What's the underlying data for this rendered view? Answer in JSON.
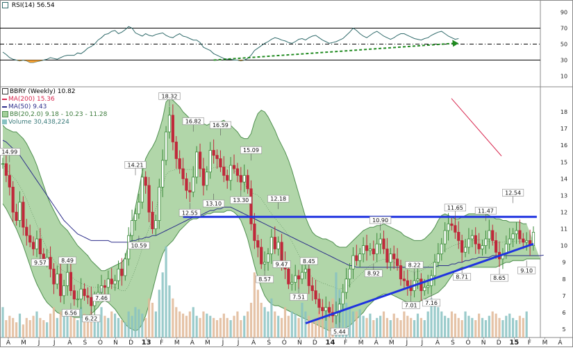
{
  "chart_data": {
    "type": "line",
    "title": "BBRY (Weekly) 10.82",
    "colors": {
      "price_up": "#3a8a3a",
      "price_down": "#c0283a",
      "bb_fill": "#a3cf9a",
      "bb_line": "#4f8f4f",
      "ma200": "#d8274f",
      "ma50": "#2b2d8a",
      "trendline": "#1f33e0",
      "rsi_line": "#2f6a6a",
      "rsi_arrow": "#1f8a1f",
      "rsi_oversold_fill": "#f5a033",
      "volume_up": "#88c2c2",
      "volume_down": "#e0b898"
    },
    "rsi": {
      "label": "RSI(14)",
      "value": "56.54",
      "ylim": [
        0,
        100
      ],
      "ticks": [
        "90",
        "70",
        "50",
        "30",
        "10"
      ],
      "levels": [
        70,
        50,
        30
      ],
      "series": [
        40,
        37,
        33,
        31,
        30,
        29,
        30,
        29,
        27,
        27,
        28,
        29,
        30,
        31,
        33,
        32,
        31,
        33,
        35,
        36,
        36,
        36,
        39,
        38,
        41,
        45,
        47,
        50,
        55,
        58,
        62,
        63,
        66,
        67,
        63,
        65,
        68,
        72,
        70,
        64,
        62,
        60,
        63,
        61,
        60,
        62,
        63,
        64,
        61,
        59,
        58,
        61,
        63,
        60,
        59,
        57,
        55,
        55,
        52,
        46,
        44,
        42,
        38,
        36,
        34,
        32,
        31,
        31,
        30,
        30,
        29,
        30,
        32,
        36,
        42,
        45,
        48,
        51,
        53,
        56,
        58,
        57,
        55,
        54,
        52,
        51,
        53,
        56,
        57,
        55,
        58,
        60,
        61,
        58,
        55,
        53,
        51,
        52,
        53,
        55,
        57,
        61,
        65,
        70,
        67,
        63,
        60,
        58,
        61,
        64,
        66,
        63,
        60,
        58,
        56,
        58,
        61,
        63,
        63,
        61,
        59,
        57,
        56,
        55,
        57,
        58,
        61,
        63,
        65,
        66,
        63,
        60,
        58,
        56,
        57
      ],
      "arrow": {
        "from": [
          62,
          30
        ],
        "to": [
          134,
          51
        ]
      }
    },
    "price": {
      "ylim": [
        4.5,
        19.5
      ],
      "ticks": [
        "18",
        "17",
        "16",
        "15",
        "14",
        "13",
        "12",
        "11",
        "10",
        "9",
        "8",
        "7",
        "6",
        "5"
      ],
      "legend": [
        {
          "text": "BBRY (Weekly) 10.82",
          "color": "#000000",
          "swatch": "candle"
        },
        {
          "text": "MA(200) 15.36",
          "color": "#d8274f",
          "swatch": "line"
        },
        {
          "text": "MA(50) 9.43",
          "color": "#2b2d8a",
          "swatch": "line"
        },
        {
          "text": "BB(20,2.0) 9.18 - 10.23 - 11.28",
          "color": "#3a7a3a",
          "swatch": "band"
        },
        {
          "text": "Volume 30,438,224",
          "color": "#3a7a7a",
          "swatch": "bars"
        }
      ],
      "close": [
        14.9,
        14.2,
        13.5,
        12.0,
        11.5,
        12.6,
        11.1,
        10.6,
        10.2,
        9.8,
        10.4,
        9.5,
        9.1,
        9.3,
        8.6,
        7.7,
        8.3,
        7.0,
        7.6,
        8.4,
        7.3,
        6.8,
        6.8,
        7.4,
        7.0,
        6.9,
        6.4,
        6.9,
        7.2,
        7.6,
        7.5,
        8.0,
        7.7,
        7.9,
        8.6,
        8.2,
        9.2,
        10.6,
        11.5,
        11.9,
        12.6,
        14.1,
        13.6,
        12.0,
        11.0,
        11.5,
        13.5,
        15.1,
        16.8,
        17.8,
        16.2,
        15.2,
        14.6,
        14.0,
        13.3,
        13.2,
        14.1,
        15.6,
        14.6,
        13.6,
        14.4,
        15.7,
        15.4,
        15.2,
        14.7,
        14.2,
        13.9,
        14.8,
        14.6,
        14.2,
        13.8,
        14.2,
        13.4,
        11.3,
        10.3,
        9.9,
        8.9,
        9.0,
        9.5,
        10.5,
        9.8,
        10.2,
        9.0,
        8.6,
        7.7,
        7.8,
        8.2,
        8.0,
        8.4,
        8.6,
        7.6,
        7.3,
        6.8,
        6.3,
        6.1,
        6.3,
        6.0,
        5.8,
        6.0,
        6.5,
        7.2,
        8.0,
        8.6,
        9.4,
        9.1,
        9.5,
        10.0,
        9.7,
        9.8,
        9.5,
        10.1,
        10.4,
        9.8,
        9.0,
        9.5,
        9.2,
        8.8,
        8.0,
        7.9,
        7.6,
        7.3,
        7.9,
        8.0,
        7.3,
        7.5,
        7.6,
        8.2,
        9.0,
        9.5,
        10.1,
        10.9,
        11.3,
        11.2,
        10.8,
        10.3,
        9.6,
        9.9,
        10.4,
        10.6,
        10.1,
        9.8,
        10.0,
        10.4,
        10.9,
        10.3,
        9.6,
        9.2,
        9.5,
        10.1,
        10.4,
        10.7,
        10.9,
        10.4,
        10.2,
        10.3,
        10.0,
        10.8
      ],
      "bb_upper": [
        17.2,
        17.0,
        16.9,
        16.8,
        16.8,
        16.6,
        16.4,
        16.1,
        15.7,
        15.3,
        14.8,
        14.2,
        13.6,
        13.0,
        12.5,
        12.1,
        11.7,
        11.3,
        11.1,
        10.9,
        10.6,
        10.3,
        10.0,
        9.8,
        9.6,
        9.4,
        9.1,
        8.9,
        8.7,
        8.5,
        8.5,
        8.6,
        8.7,
        8.8,
        8.9,
        9.0,
        9.3,
        10.1,
        11.2,
        12.3,
        13.3,
        14.4,
        15.2,
        15.6,
        15.9,
        16.3,
        16.9,
        17.6,
        18.6,
        18.8,
        18.7,
        18.5,
        18.3,
        18.0,
        17.8,
        17.6,
        17.5,
        17.6,
        17.5,
        17.3,
        17.2,
        17.3,
        17.3,
        17.4,
        17.4,
        17.5,
        17.3,
        17.2,
        17.0,
        16.8,
        16.5,
        16.4,
        16.4,
        16.7,
        17.4,
        17.9,
        18.1,
        18.0,
        17.7,
        17.3,
        16.9,
        16.4,
        16.0,
        15.6,
        15.1,
        14.5,
        13.8,
        13.1,
        12.4,
        11.7,
        11.2,
        10.8,
        10.6,
        10.5,
        10.4,
        10.4,
        10.3,
        10.2,
        10.0,
        9.9,
        9.9,
        9.9,
        10.1,
        10.3,
        10.5,
        10.7,
        10.9,
        11.0,
        11.1,
        11.1,
        11.2,
        11.2,
        11.3,
        11.2,
        11.1,
        11.0,
        10.9,
        10.8,
        10.6,
        10.5,
        10.4,
        10.3,
        10.3,
        10.3,
        10.4,
        10.6,
        10.8,
        11.1,
        11.5,
        11.8,
        11.9,
        11.8,
        11.7,
        11.6,
        11.6,
        11.7,
        11.8,
        11.9,
        11.9,
        11.9,
        12.0,
        12.0,
        11.9,
        11.8,
        11.7,
        11.6,
        11.6,
        11.5,
        11.5,
        11.4,
        11.4,
        11.4,
        11.4,
        11.3,
        11.3
      ],
      "bb_lower": [
        12.5,
        12.2,
        11.8,
        11.4,
        11.0,
        10.5,
        10.0,
        9.4,
        8.8,
        8.2,
        7.7,
        7.3,
        6.9,
        6.6,
        6.4,
        6.2,
        6.0,
        5.9,
        5.8,
        5.8,
        5.8,
        5.7,
        5.7,
        5.7,
        5.7,
        5.8,
        5.9,
        6.1,
        6.3,
        6.6,
        6.7,
        6.6,
        6.4,
        6.2,
        5.9,
        5.6,
        5.3,
        5.1,
        5.0,
        4.9,
        5.0,
        5.3,
        5.8,
        6.5,
        7.3,
        8.1,
        8.9,
        9.5,
        9.9,
        10.1,
        10.3,
        10.6,
        10.9,
        11.1,
        11.3,
        11.5,
        11.6,
        11.6,
        11.7,
        11.8,
        11.9,
        11.9,
        12.0,
        12.0,
        12.0,
        12.0,
        12.1,
        12.1,
        12.0,
        11.8,
        11.5,
        11.0,
        10.4,
        9.6,
        8.8,
        8.1,
        7.5,
        7.0,
        6.7,
        6.5,
        6.4,
        6.4,
        6.3,
        6.2,
        6.1,
        6.0,
        5.9,
        5.8,
        5.7,
        5.6,
        5.5,
        5.4,
        5.3,
        5.2,
        5.1,
        5.0,
        4.9,
        4.9,
        4.9,
        4.9,
        5.0,
        5.1,
        5.2,
        5.4,
        5.6,
        5.8,
        6.0,
        6.3,
        6.5,
        6.7,
        6.9,
        7.0,
        7.1,
        7.1,
        7.1,
        7.0,
        6.9,
        6.8,
        6.7,
        6.6,
        6.5,
        6.5,
        6.6,
        6.7,
        6.8,
        6.9,
        7.0,
        7.1,
        7.2,
        7.4,
        7.6,
        7.9,
        8.2,
        8.5,
        8.6,
        8.7,
        8.7,
        8.7,
        8.7,
        8.7,
        8.7,
        8.7,
        8.7,
        8.7,
        8.7,
        8.7,
        8.8,
        8.9,
        9.0,
        9.0,
        9.1,
        9.1,
        9.1,
        9.1,
        9.2,
        9.2,
        9.2,
        9.2,
        9.2
      ],
      "ma50": [
        16.3,
        16.2,
        16.0,
        15.8,
        15.6,
        15.4,
        15.1,
        14.8,
        14.5,
        14.2,
        13.9,
        13.6,
        13.3,
        13.0,
        12.7,
        12.4,
        12.1,
        11.8,
        11.5,
        11.3,
        11.1,
        10.9,
        10.7,
        10.6,
        10.5,
        10.4,
        10.3,
        10.3,
        10.3,
        10.3,
        10.3,
        10.3,
        10.2,
        10.2,
        10.2,
        10.2,
        10.2,
        10.2,
        10.3,
        10.3,
        10.4,
        10.4,
        10.5,
        10.5,
        10.6,
        10.6,
        10.7,
        10.8,
        10.9,
        11.0,
        11.1,
        11.2,
        11.3,
        11.4,
        11.5,
        11.6,
        11.7,
        11.7,
        11.8,
        11.9,
        12.0,
        12.1,
        12.1,
        12.2,
        12.2,
        12.3,
        12.3,
        12.3,
        12.2,
        12.1,
        12.0,
        11.9,
        11.8,
        11.7,
        11.6,
        11.5,
        11.4,
        11.3,
        11.2,
        11.1,
        11.0,
        10.9,
        10.8,
        10.7,
        10.6,
        10.5,
        10.4,
        10.3,
        10.2,
        10.1,
        10.0,
        9.9,
        9.8,
        9.7,
        9.6,
        9.5,
        9.4,
        9.3,
        9.2,
        9.1,
        9.0,
        8.9,
        8.8,
        8.8,
        8.7,
        8.7,
        8.7,
        8.7,
        8.7,
        8.7,
        8.7,
        8.7,
        8.7,
        8.7,
        8.7,
        8.7,
        8.7,
        8.7,
        8.7,
        8.7,
        8.7,
        8.7,
        8.7,
        8.7,
        8.7,
        8.7,
        8.7,
        8.7,
        8.8,
        8.8,
        8.8,
        8.8,
        8.9,
        8.9,
        9.0,
        9.0,
        9.1,
        9.1,
        9.2,
        9.2,
        9.3,
        9.3,
        9.3,
        9.3,
        9.4,
        9.4,
        9.4,
        9.4,
        9.4,
        9.4,
        9.4,
        9.4,
        9.4,
        9.4,
        9.4,
        9.4,
        9.4,
        9.4,
        9.4,
        9.43
      ],
      "ma200_segment": {
        "from": [
          650,
          15.0
        ],
        "to": [
          722,
          15.36
        ]
      },
      "resistance": {
        "from_idx": 53,
        "to_idx": 157,
        "value": 11.72
      },
      "support": {
        "from": [
          440,
          5.35
        ],
        "to": [
          768,
          10.1
        ]
      },
      "annotations": [
        {
          "label": "14.99",
          "idx": 2,
          "value": 14.99,
          "pos": "above"
        },
        {
          "label": "9.57",
          "idx": 11,
          "value": 9.57,
          "pos": "below"
        },
        {
          "label": "8.49",
          "idx": 19,
          "value": 8.49,
          "pos": "above"
        },
        {
          "label": "6.56",
          "idx": 20,
          "value": 6.56,
          "pos": "below"
        },
        {
          "label": "7.46",
          "idx": 29,
          "value": 7.46,
          "pos": "below"
        },
        {
          "label": "6.22",
          "idx": 26,
          "value": 6.22,
          "pos": "below"
        },
        {
          "label": "14.21",
          "idx": 39,
          "value": 14.21,
          "pos": "above"
        },
        {
          "label": "10.59",
          "idx": 40,
          "value": 10.59,
          "pos": "below"
        },
        {
          "label": "18.32",
          "idx": 49,
          "value": 18.32,
          "pos": "above"
        },
        {
          "label": "16.82",
          "idx": 56,
          "value": 16.82,
          "pos": "above"
        },
        {
          "label": "12.55",
          "idx": 55,
          "value": 12.55,
          "pos": "below"
        },
        {
          "label": "16.59",
          "idx": 64,
          "value": 16.59,
          "pos": "above"
        },
        {
          "label": "13.10",
          "idx": 62,
          "value": 13.1,
          "pos": "below"
        },
        {
          "label": "15.09",
          "idx": 73,
          "value": 15.09,
          "pos": "above"
        },
        {
          "label": "13.30",
          "idx": 70,
          "value": 13.3,
          "pos": "below"
        },
        {
          "label": "12.18",
          "idx": 81,
          "value": 12.18,
          "pos": "above"
        },
        {
          "label": "9.47",
          "idx": 82,
          "value": 9.47,
          "pos": "below"
        },
        {
          "label": "8.57",
          "idx": 77,
          "value": 8.57,
          "pos": "below"
        },
        {
          "label": "8.45",
          "idx": 90,
          "value": 8.45,
          "pos": "above"
        },
        {
          "label": "7.51",
          "idx": 87,
          "value": 7.51,
          "pos": "below"
        },
        {
          "label": "5.44",
          "idx": 99,
          "value": 5.44,
          "pos": "below"
        },
        {
          "label": "10.90",
          "idx": 111,
          "value": 10.9,
          "pos": "above"
        },
        {
          "label": "8.92",
          "idx": 109,
          "value": 8.92,
          "pos": "below"
        },
        {
          "label": "8.22",
          "idx": 121,
          "value": 8.22,
          "pos": "above"
        },
        {
          "label": "7.01",
          "idx": 120,
          "value": 7.01,
          "pos": "below"
        },
        {
          "label": "7.16",
          "idx": 126,
          "value": 7.16,
          "pos": "below"
        },
        {
          "label": "11.65",
          "idx": 133,
          "value": 11.65,
          "pos": "above"
        },
        {
          "label": "8.71",
          "idx": 135,
          "value": 8.71,
          "pos": "below"
        },
        {
          "label": "11.47",
          "idx": 142,
          "value": 11.47,
          "pos": "above"
        },
        {
          "label": "8.65",
          "idx": 146,
          "value": 8.65,
          "pos": "below"
        },
        {
          "label": "12.54",
          "idx": 150,
          "value": 12.54,
          "pos": "above"
        },
        {
          "label": "9.10",
          "idx": 154,
          "value": 9.1,
          "pos": "below"
        }
      ]
    },
    "volume": {
      "values": [
        14,
        8,
        10,
        9,
        7,
        11,
        6,
        9,
        8,
        10,
        12,
        9,
        8,
        7,
        11,
        14,
        9,
        12,
        13,
        10,
        11,
        9,
        8,
        14,
        11,
        9,
        12,
        10,
        8,
        14,
        10,
        9,
        12,
        11,
        9,
        8,
        7,
        12,
        10,
        14,
        13,
        11,
        9,
        18,
        16,
        12,
        22,
        30,
        42,
        24,
        18,
        14,
        12,
        11,
        10,
        12,
        14,
        10,
        9,
        12,
        11,
        10,
        9,
        8,
        9,
        11,
        9,
        8,
        10,
        12,
        8,
        10,
        12,
        16,
        30,
        22,
        16,
        14,
        12,
        18,
        12,
        10,
        9,
        14,
        10,
        12,
        11,
        9,
        16,
        12,
        10,
        8,
        9,
        12,
        16,
        14,
        12,
        18,
        30,
        22,
        20,
        16,
        14,
        12,
        12,
        13,
        10,
        9,
        11,
        8,
        9,
        10,
        12,
        9,
        8,
        11,
        9,
        8,
        12,
        10,
        9,
        8,
        11,
        9,
        8,
        12,
        18,
        16,
        14,
        12,
        10,
        9,
        12,
        11,
        9,
        8,
        12,
        10,
        9,
        8,
        11,
        9,
        8,
        10,
        12,
        11,
        9,
        8,
        10,
        11,
        9,
        8,
        10,
        9,
        12
      ],
      "max": 48
    },
    "x_axis": {
      "labels": [
        "A",
        "M",
        "J",
        "J",
        "A",
        "S",
        "O",
        "N",
        "D",
        "13",
        "F",
        "M",
        "A",
        "M",
        "J",
        "J",
        "A",
        "S",
        "O",
        "N",
        "D",
        "14",
        "F",
        "M",
        "A",
        "M",
        "J",
        "J",
        "A",
        "S",
        "O",
        "N",
        "D",
        "15",
        "F",
        "M",
        "A"
      ],
      "bold": [
        "13",
        "14",
        "15"
      ],
      "first_x": 12,
      "step": 22.07,
      "weeks_per_month": 4.33
    }
  }
}
